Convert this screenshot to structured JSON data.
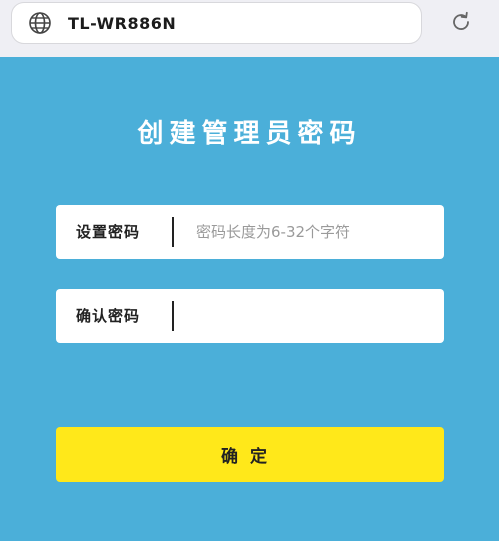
{
  "browser": {
    "url": "TL-WR886N",
    "globe_icon": "globe-icon",
    "refresh_icon": "refresh-icon"
  },
  "page": {
    "title": "创建管理员密码",
    "set_password": {
      "label": "设置密码",
      "placeholder": "密码长度为6-32个字符",
      "value": ""
    },
    "confirm_password": {
      "label": "确认密码",
      "placeholder": "",
      "value": ""
    },
    "confirm_button": "确定"
  },
  "colors": {
    "background": "#4BAFD9",
    "button": "#FFE81A",
    "topbar": "#EFEFF4"
  }
}
